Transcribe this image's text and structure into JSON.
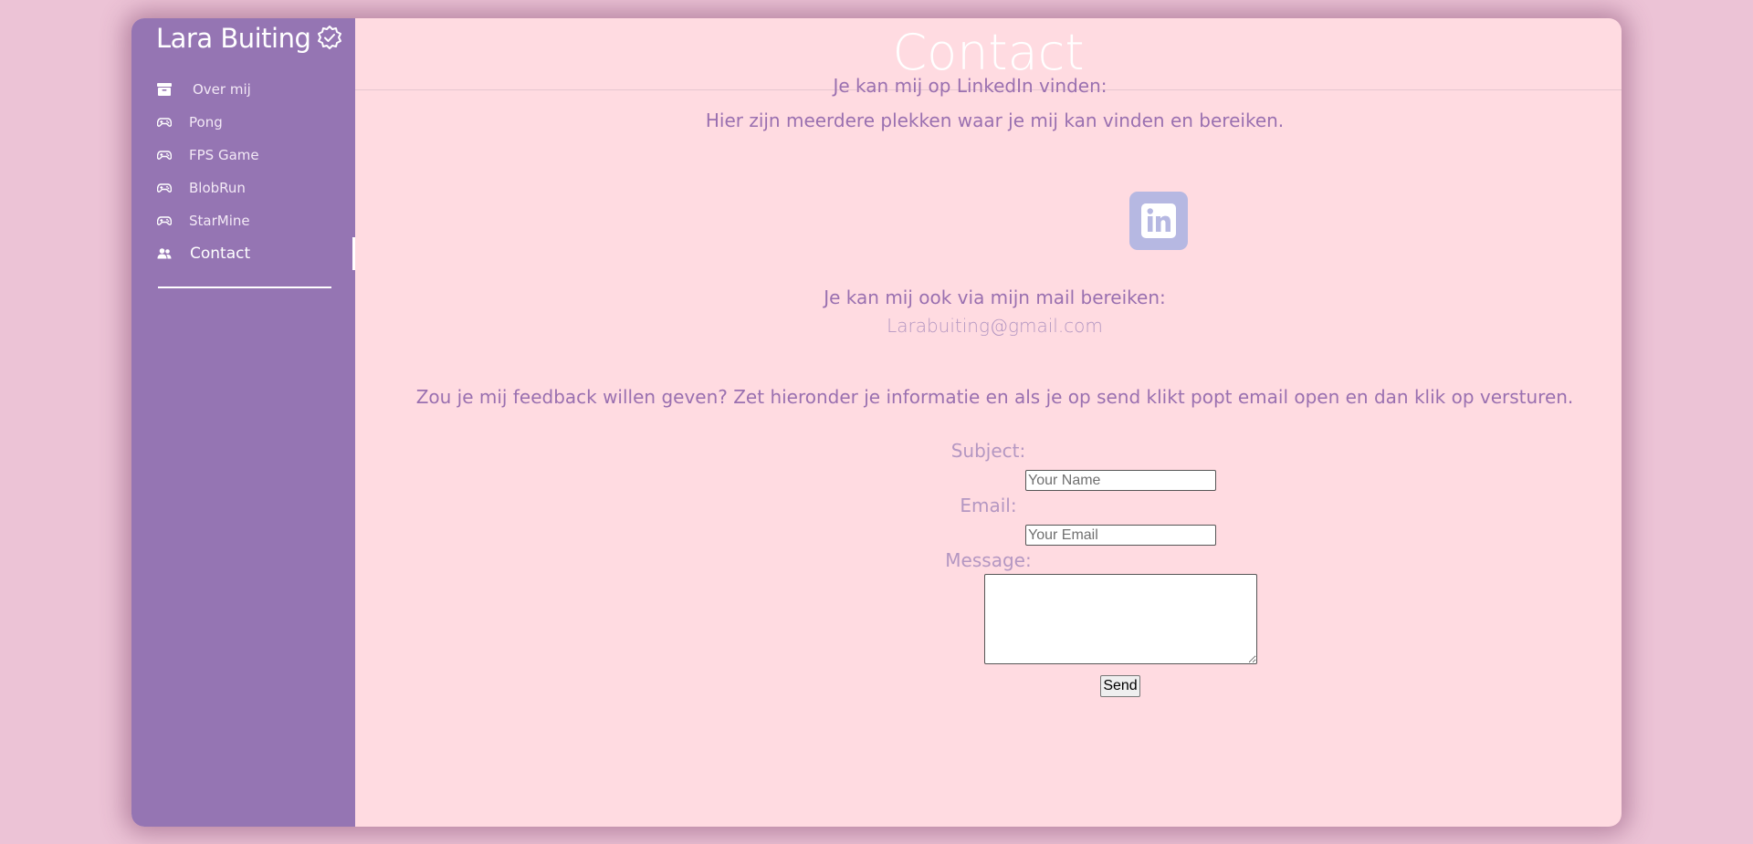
{
  "sidebar": {
    "brand": "Lara Buiting",
    "items": [
      {
        "label": "Over mij",
        "icon": "archive-icon"
      },
      {
        "label": "Pong",
        "icon": "gamepad-icon"
      },
      {
        "label": "FPS Game",
        "icon": "gamepad-icon"
      },
      {
        "label": "BlobRun",
        "icon": "gamepad-icon"
      },
      {
        "label": "StarMine",
        "icon": "gamepad-icon"
      },
      {
        "label": "Contact",
        "icon": "users-icon",
        "active": true
      }
    ]
  },
  "main": {
    "title": "Contact",
    "intro": "Hier zijn meerdere plekken waar je mij kan vinden en bereiken.",
    "linkedin_text": "Je kan mij op LinkedIn vinden:",
    "mail_title": "Je kan mij ook via mijn mail bereiken:",
    "mail_address": "Larabuiting@gmail.com",
    "feedback": "Zou je mij feedback willen geven? Zet hieronder je informatie en als je op send klikt popt email open en dan klik op versturen."
  },
  "form": {
    "subject_label": "Subject:",
    "subject_placeholder": "Your Name",
    "email_label": "Email:",
    "email_placeholder": "Your Email",
    "message_label": "Message:",
    "send_label": "Send"
  },
  "colors": {
    "background": "#ecc3d6",
    "sidebar": "#9575b3",
    "content": "#ffdbe1",
    "text": "#9a70b0",
    "linkedin_button": "#b6b8e2"
  }
}
